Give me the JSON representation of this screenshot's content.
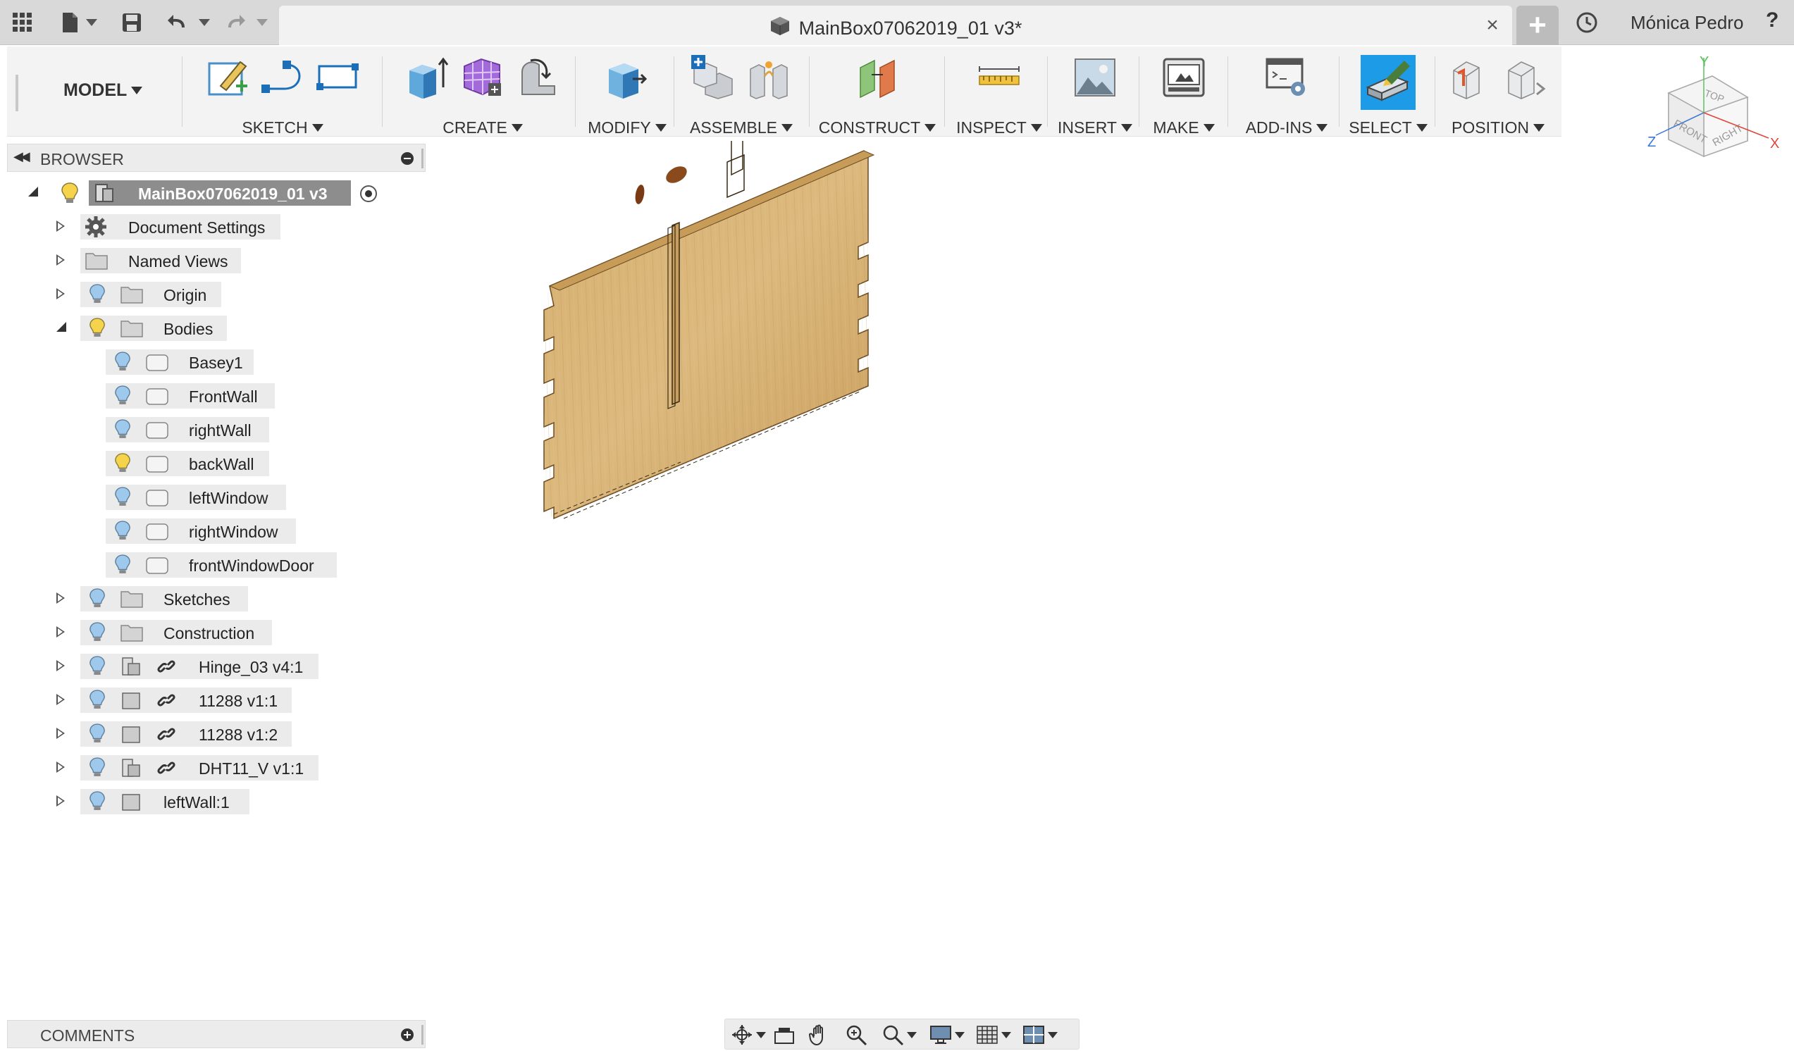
{
  "title_bar": {
    "document_title": "MainBox07062019_01 v3*",
    "user_name": "Mónica Pedro",
    "help": "?",
    "new_tab": "+",
    "close": "×"
  },
  "toolbar": {
    "workspace": "MODEL",
    "groups": [
      {
        "label": "SKETCH",
        "icons": [
          "create-sketch-icon",
          "line-icon",
          "rectangle-icon"
        ]
      },
      {
        "label": "CREATE",
        "icons": [
          "extrude-icon",
          "form-icon",
          "revolve-icon"
        ]
      },
      {
        "label": "MODIFY",
        "icons": [
          "press-pull-icon"
        ]
      },
      {
        "label": "ASSEMBLE",
        "icons": [
          "new-component-icon",
          "joint-icon"
        ]
      },
      {
        "label": "CONSTRUCT",
        "icons": [
          "offset-plane-icon"
        ]
      },
      {
        "label": "INSPECT",
        "icons": [
          "measure-icon"
        ]
      },
      {
        "label": "INSERT",
        "icons": [
          "insert-image-icon"
        ]
      },
      {
        "label": "MAKE",
        "icons": [
          "3d-print-icon"
        ]
      },
      {
        "label": "ADD-INS",
        "icons": [
          "scripts-addins-icon"
        ]
      },
      {
        "label": "SELECT",
        "icons": [
          "select-icon"
        ]
      },
      {
        "label": "POSITION",
        "icons": [
          "capture-position-icon",
          "revert-position-icon"
        ]
      }
    ]
  },
  "browser": {
    "title": "BROWSER",
    "root": {
      "label": "MainBox07062019_01 v3"
    },
    "items": [
      {
        "label": "Document Settings"
      },
      {
        "label": "Named Views"
      },
      {
        "label": "Origin"
      },
      {
        "label": "Bodies"
      },
      {
        "label": "Basey1"
      },
      {
        "label": "FrontWall"
      },
      {
        "label": "rightWall"
      },
      {
        "label": "backWall"
      },
      {
        "label": "leftWindow"
      },
      {
        "label": "rightWindow"
      },
      {
        "label": "frontWindowDoor"
      },
      {
        "label": "Sketches"
      },
      {
        "label": "Construction"
      },
      {
        "label": "Hinge_03 v4:1"
      },
      {
        "label": "11288 v1:1"
      },
      {
        "label": "11288 v1:2"
      },
      {
        "label": "DHT11_V v1:1"
      },
      {
        "label": "leftWall:1"
      }
    ]
  },
  "comments": {
    "title": "COMMENTS"
  },
  "viewcube": {
    "top": "TOP",
    "front": "FRONT",
    "right": "RIGHT",
    "axis_x": "X",
    "axis_y": "Y",
    "axis_z": "Z"
  },
  "colors": {
    "accent_blue": "#1e9be6",
    "wood": "#d2a96a",
    "bulb_yellow": "#f5d44b",
    "bulb_blue": "#9ec9ec"
  }
}
